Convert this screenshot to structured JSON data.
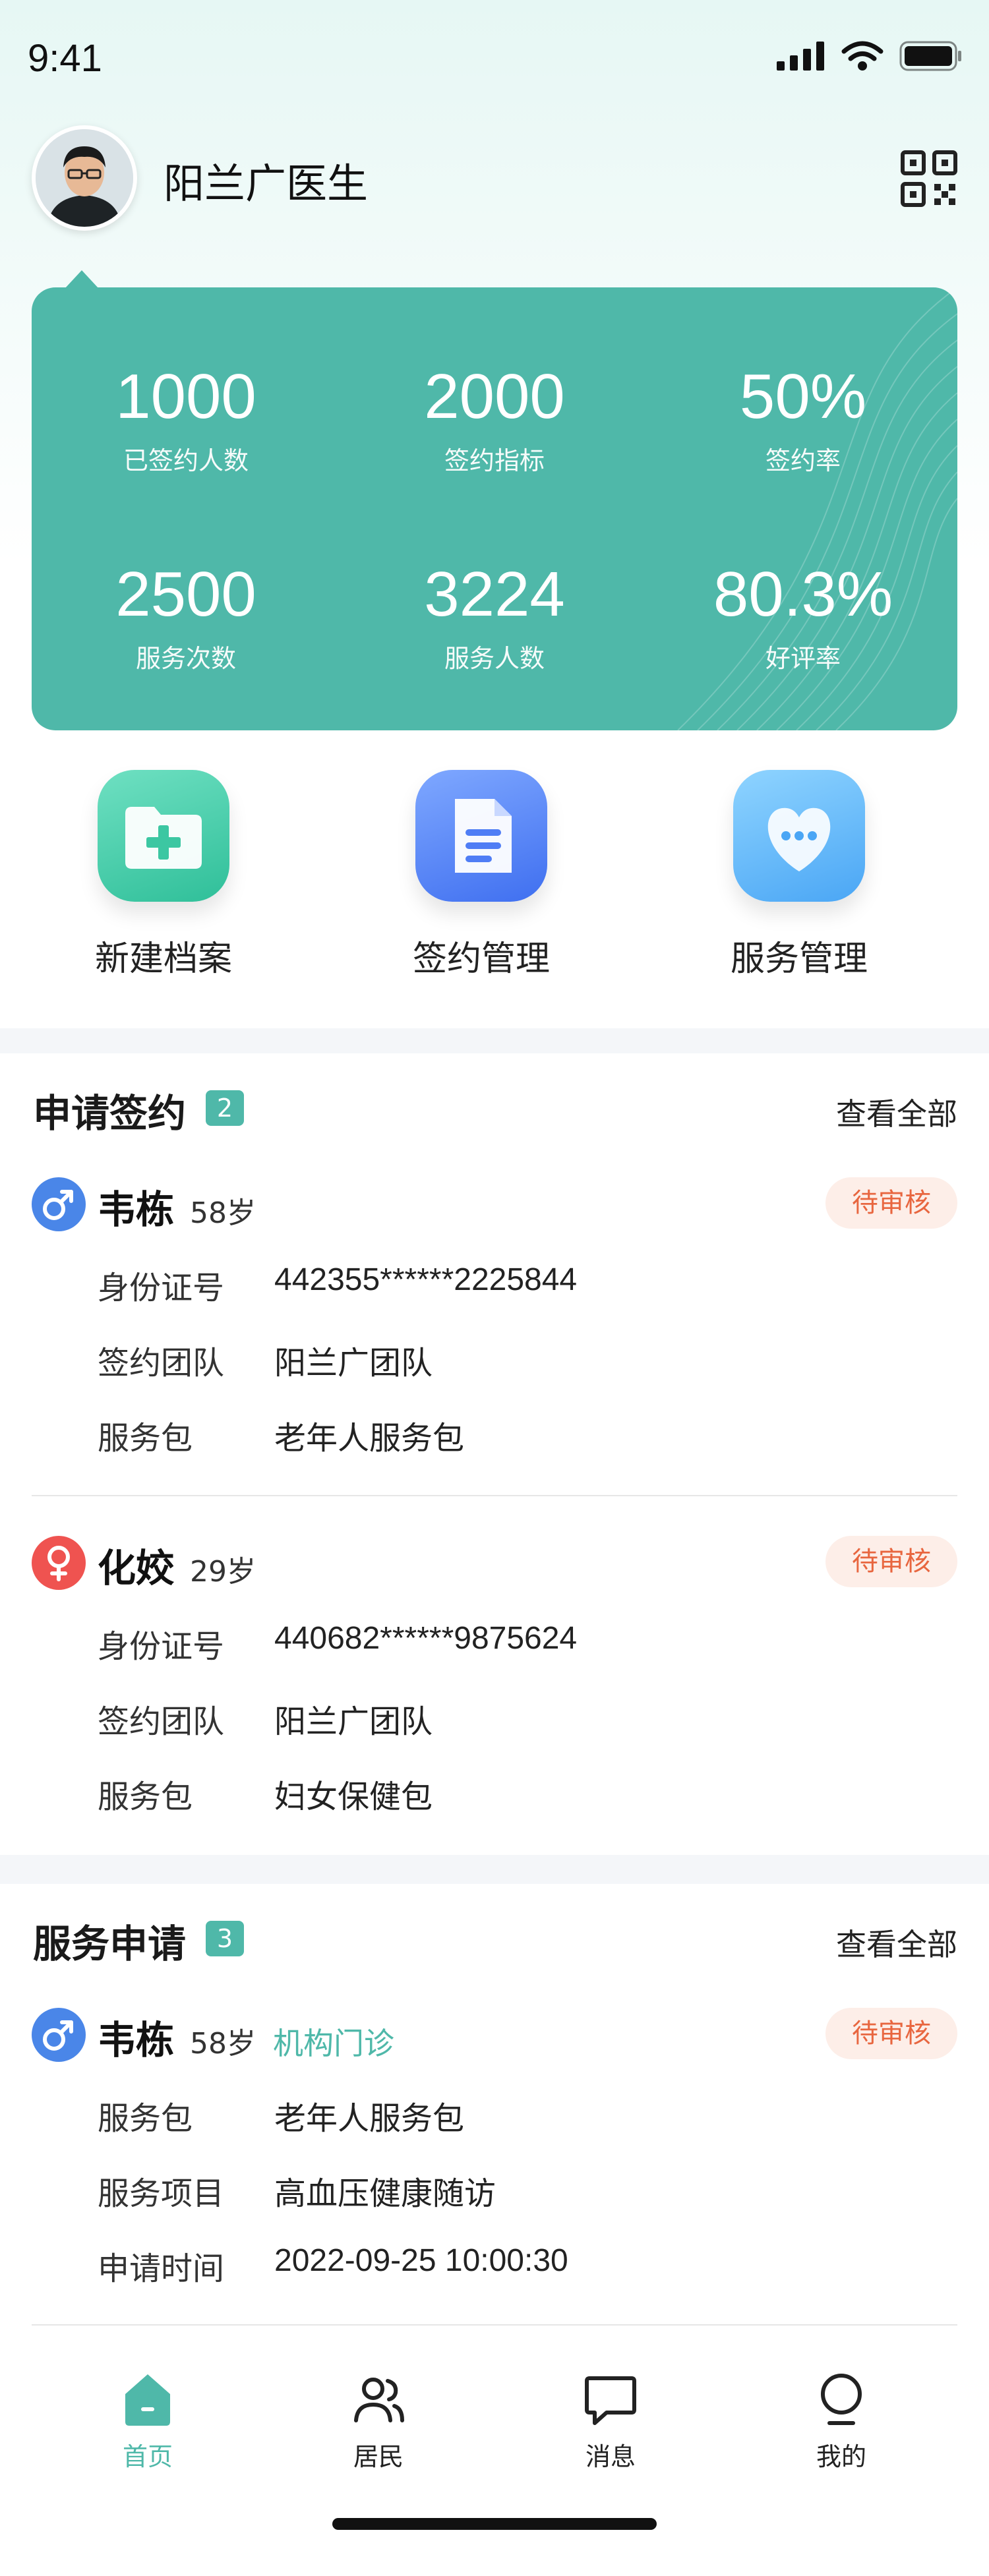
{
  "status_bar": {
    "time": "9:41"
  },
  "profile": {
    "doctor_name": "阳兰广医生"
  },
  "stats": [
    {
      "value": "1000",
      "label": "已签约人数"
    },
    {
      "value": "2000",
      "label": "签约指标"
    },
    {
      "value": "50%",
      "label": "签约率"
    },
    {
      "value": "2500",
      "label": "服务次数"
    },
    {
      "value": "3224",
      "label": "服务人数"
    },
    {
      "value": "80.3%",
      "label": "好评率"
    }
  ],
  "quick_actions": [
    {
      "label": "新建档案",
      "icon": "folder-plus-icon"
    },
    {
      "label": "签约管理",
      "icon": "document-icon"
    },
    {
      "label": "服务管理",
      "icon": "heart-chat-icon"
    }
  ],
  "sign_requests": {
    "title": "申请签约",
    "count": "2",
    "view_all": "查看全部",
    "items": [
      {
        "name": "韦栋",
        "age": "58岁",
        "gender": "male",
        "status": "待审核",
        "fields": [
          {
            "label": "身份证号",
            "value": "442355******2225844"
          },
          {
            "label": "签约团队",
            "value": "阳兰广团队"
          },
          {
            "label": "服务包",
            "value": "老年人服务包"
          }
        ]
      },
      {
        "name": "化姣",
        "age": "29岁",
        "gender": "female",
        "status": "待审核",
        "fields": [
          {
            "label": "身份证号",
            "value": "440682******9875624"
          },
          {
            "label": "签约团队",
            "value": "阳兰广团队"
          },
          {
            "label": "服务包",
            "value": "妇女保健包"
          }
        ]
      }
    ]
  },
  "service_requests": {
    "title": "服务申请",
    "count": "3",
    "view_all": "查看全部",
    "items": [
      {
        "name": "韦栋",
        "age": "58岁",
        "gender": "male",
        "tag": "机构门诊",
        "status": "待审核",
        "fields": [
          {
            "label": "服务包",
            "value": "老年人服务包"
          },
          {
            "label": "服务项目",
            "value": "高血压健康随访"
          },
          {
            "label": "申请时间",
            "value": "2022-09-25 10:00:30"
          }
        ]
      }
    ]
  },
  "tabbar": [
    {
      "label": "首页",
      "icon": "home-icon",
      "active": true
    },
    {
      "label": "居民",
      "icon": "residents-icon",
      "active": false
    },
    {
      "label": "消息",
      "icon": "message-icon",
      "active": false
    },
    {
      "label": "我的",
      "icon": "profile-icon",
      "active": false
    }
  ],
  "colors": {
    "accent": "#4fb8a9",
    "male": "#4a86e8",
    "female": "#ef5350",
    "pending_bg": "#fdeee8",
    "pending_text": "#e8663f"
  }
}
